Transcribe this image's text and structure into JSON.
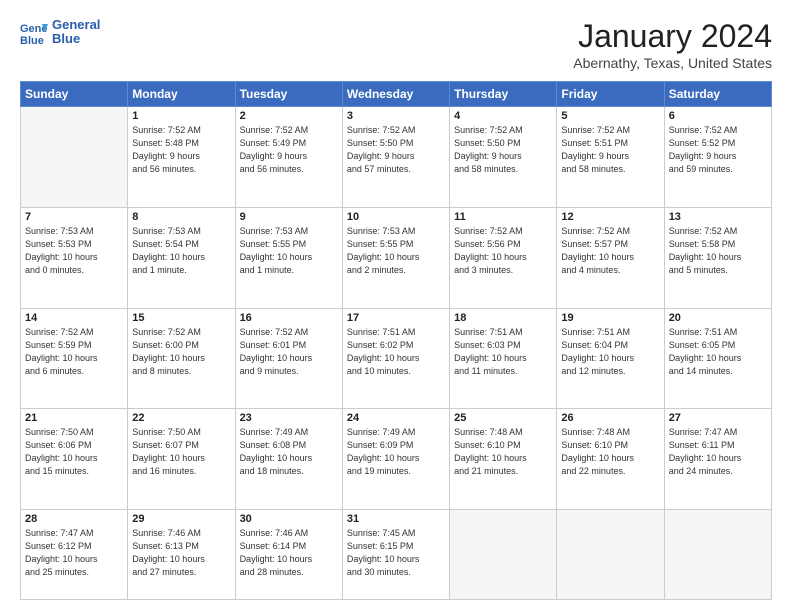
{
  "header": {
    "logo_line1": "General",
    "logo_line2": "Blue",
    "month_title": "January 2024",
    "location": "Abernathy, Texas, United States"
  },
  "weekdays": [
    "Sunday",
    "Monday",
    "Tuesday",
    "Wednesday",
    "Thursday",
    "Friday",
    "Saturday"
  ],
  "weeks": [
    [
      {
        "day": "",
        "info": ""
      },
      {
        "day": "1",
        "info": "Sunrise: 7:52 AM\nSunset: 5:48 PM\nDaylight: 9 hours\nand 56 minutes."
      },
      {
        "day": "2",
        "info": "Sunrise: 7:52 AM\nSunset: 5:49 PM\nDaylight: 9 hours\nand 56 minutes."
      },
      {
        "day": "3",
        "info": "Sunrise: 7:52 AM\nSunset: 5:50 PM\nDaylight: 9 hours\nand 57 minutes."
      },
      {
        "day": "4",
        "info": "Sunrise: 7:52 AM\nSunset: 5:50 PM\nDaylight: 9 hours\nand 58 minutes."
      },
      {
        "day": "5",
        "info": "Sunrise: 7:52 AM\nSunset: 5:51 PM\nDaylight: 9 hours\nand 58 minutes."
      },
      {
        "day": "6",
        "info": "Sunrise: 7:52 AM\nSunset: 5:52 PM\nDaylight: 9 hours\nand 59 minutes."
      }
    ],
    [
      {
        "day": "7",
        "info": "Sunrise: 7:53 AM\nSunset: 5:53 PM\nDaylight: 10 hours\nand 0 minutes."
      },
      {
        "day": "8",
        "info": "Sunrise: 7:53 AM\nSunset: 5:54 PM\nDaylight: 10 hours\nand 1 minute."
      },
      {
        "day": "9",
        "info": "Sunrise: 7:53 AM\nSunset: 5:55 PM\nDaylight: 10 hours\nand 1 minute."
      },
      {
        "day": "10",
        "info": "Sunrise: 7:53 AM\nSunset: 5:55 PM\nDaylight: 10 hours\nand 2 minutes."
      },
      {
        "day": "11",
        "info": "Sunrise: 7:52 AM\nSunset: 5:56 PM\nDaylight: 10 hours\nand 3 minutes."
      },
      {
        "day": "12",
        "info": "Sunrise: 7:52 AM\nSunset: 5:57 PM\nDaylight: 10 hours\nand 4 minutes."
      },
      {
        "day": "13",
        "info": "Sunrise: 7:52 AM\nSunset: 5:58 PM\nDaylight: 10 hours\nand 5 minutes."
      }
    ],
    [
      {
        "day": "14",
        "info": "Sunrise: 7:52 AM\nSunset: 5:59 PM\nDaylight: 10 hours\nand 6 minutes."
      },
      {
        "day": "15",
        "info": "Sunrise: 7:52 AM\nSunset: 6:00 PM\nDaylight: 10 hours\nand 8 minutes."
      },
      {
        "day": "16",
        "info": "Sunrise: 7:52 AM\nSunset: 6:01 PM\nDaylight: 10 hours\nand 9 minutes."
      },
      {
        "day": "17",
        "info": "Sunrise: 7:51 AM\nSunset: 6:02 PM\nDaylight: 10 hours\nand 10 minutes."
      },
      {
        "day": "18",
        "info": "Sunrise: 7:51 AM\nSunset: 6:03 PM\nDaylight: 10 hours\nand 11 minutes."
      },
      {
        "day": "19",
        "info": "Sunrise: 7:51 AM\nSunset: 6:04 PM\nDaylight: 10 hours\nand 12 minutes."
      },
      {
        "day": "20",
        "info": "Sunrise: 7:51 AM\nSunset: 6:05 PM\nDaylight: 10 hours\nand 14 minutes."
      }
    ],
    [
      {
        "day": "21",
        "info": "Sunrise: 7:50 AM\nSunset: 6:06 PM\nDaylight: 10 hours\nand 15 minutes."
      },
      {
        "day": "22",
        "info": "Sunrise: 7:50 AM\nSunset: 6:07 PM\nDaylight: 10 hours\nand 16 minutes."
      },
      {
        "day": "23",
        "info": "Sunrise: 7:49 AM\nSunset: 6:08 PM\nDaylight: 10 hours\nand 18 minutes."
      },
      {
        "day": "24",
        "info": "Sunrise: 7:49 AM\nSunset: 6:09 PM\nDaylight: 10 hours\nand 19 minutes."
      },
      {
        "day": "25",
        "info": "Sunrise: 7:48 AM\nSunset: 6:10 PM\nDaylight: 10 hours\nand 21 minutes."
      },
      {
        "day": "26",
        "info": "Sunrise: 7:48 AM\nSunset: 6:10 PM\nDaylight: 10 hours\nand 22 minutes."
      },
      {
        "day": "27",
        "info": "Sunrise: 7:47 AM\nSunset: 6:11 PM\nDaylight: 10 hours\nand 24 minutes."
      }
    ],
    [
      {
        "day": "28",
        "info": "Sunrise: 7:47 AM\nSunset: 6:12 PM\nDaylight: 10 hours\nand 25 minutes."
      },
      {
        "day": "29",
        "info": "Sunrise: 7:46 AM\nSunset: 6:13 PM\nDaylight: 10 hours\nand 27 minutes."
      },
      {
        "day": "30",
        "info": "Sunrise: 7:46 AM\nSunset: 6:14 PM\nDaylight: 10 hours\nand 28 minutes."
      },
      {
        "day": "31",
        "info": "Sunrise: 7:45 AM\nSunset: 6:15 PM\nDaylight: 10 hours\nand 30 minutes."
      },
      {
        "day": "",
        "info": ""
      },
      {
        "day": "",
        "info": ""
      },
      {
        "day": "",
        "info": ""
      }
    ]
  ]
}
